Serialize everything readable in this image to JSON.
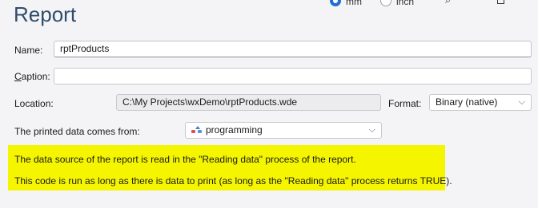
{
  "header": {
    "title": "Report",
    "units": [
      {
        "label": "mm",
        "checked": true
      },
      {
        "label": "inch",
        "checked": false
      }
    ],
    "icons": [
      "search-icon",
      "window-square-icon"
    ]
  },
  "form": {
    "name_label": "Name:",
    "name_value": "rptProducts",
    "caption_label_first": "C",
    "caption_label_rest": "aption:",
    "caption_value": "",
    "location_label": "Location:",
    "location_value": "C:\\My Projects\\wxDemo\\rptProducts.wde",
    "format_label": "Format:",
    "format_value": "Binary (native)",
    "source_label": "The printed data comes from:",
    "source_value": "programming"
  },
  "note": {
    "line1": "The data source of the report is read in the \"Reading data\" process of the report.",
    "line2": "This code is run as long as there is data to print (as long as the \"Reading data\" process returns TRUE).",
    "background": "#f5f500"
  },
  "colors": {
    "accent": "#1f6fd0",
    "title": "#2e4d6b"
  }
}
